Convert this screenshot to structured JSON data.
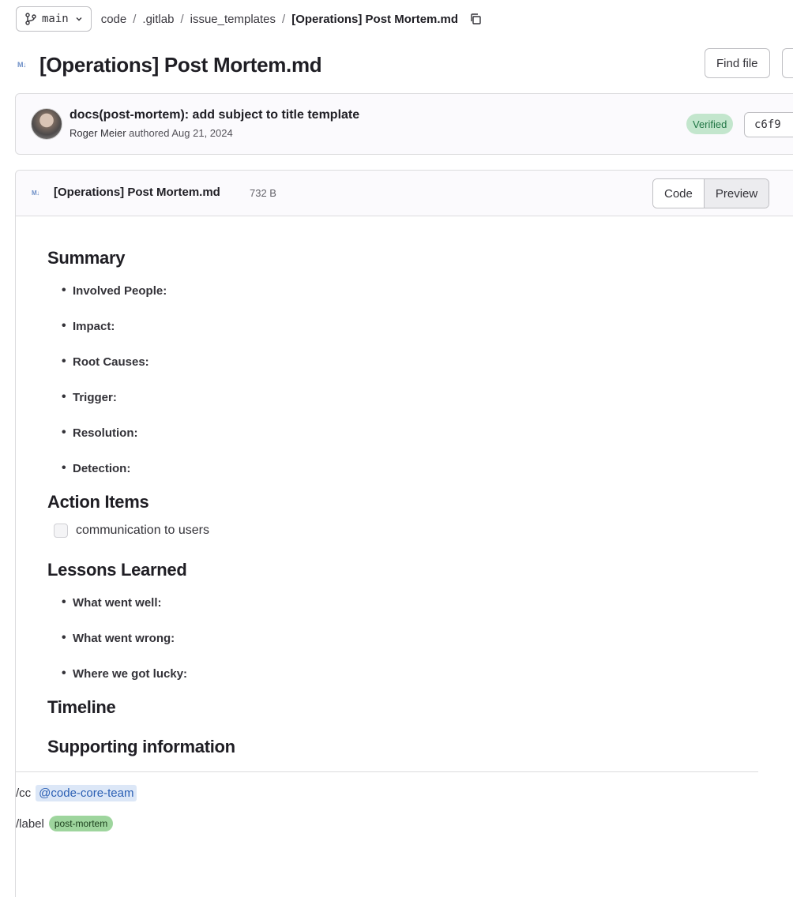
{
  "breadcrumb": {
    "branch": "main",
    "segments": [
      "code",
      ".gitlab",
      "issue_templates"
    ],
    "current": "[Operations] Post Mortem.md",
    "separator": "/"
  },
  "header": {
    "title": "[Operations] Post Mortem.md",
    "find_file_label": "Find file",
    "md_badge": "M↓"
  },
  "commit": {
    "message": "docs(post-mortem): add subject to title template",
    "author": "Roger Meier",
    "authored_text": "authored Aug 21, 2024",
    "verified_label": "Verified",
    "sha": "c6f9"
  },
  "viewer": {
    "file_name": "[Operations] Post Mortem.md",
    "file_size": "732 B",
    "code_label": "Code",
    "preview_label": "Preview"
  },
  "doc": {
    "summary_heading": "Summary",
    "summary_items": [
      "Involved People:",
      "Impact:",
      "Root Causes:",
      "Trigger:",
      "Resolution:",
      "Detection:"
    ],
    "action_heading": "Action Items",
    "action_task": "communication to users",
    "lessons_heading": "Lessons Learned",
    "lessons_items": [
      "What went well:",
      "What went wrong:",
      "Where we got lucky:"
    ],
    "timeline_heading": "Timeline",
    "supporting_heading": "Supporting information",
    "cc_cmd": "/cc",
    "cc_mention": "@code-core-team",
    "label_cmd": "/label",
    "label_value": "post-mortem"
  },
  "colors": {
    "verified_bg": "#c3e6cd",
    "mention_bg": "#dce7f7",
    "label_bg": "#9ed59d"
  }
}
